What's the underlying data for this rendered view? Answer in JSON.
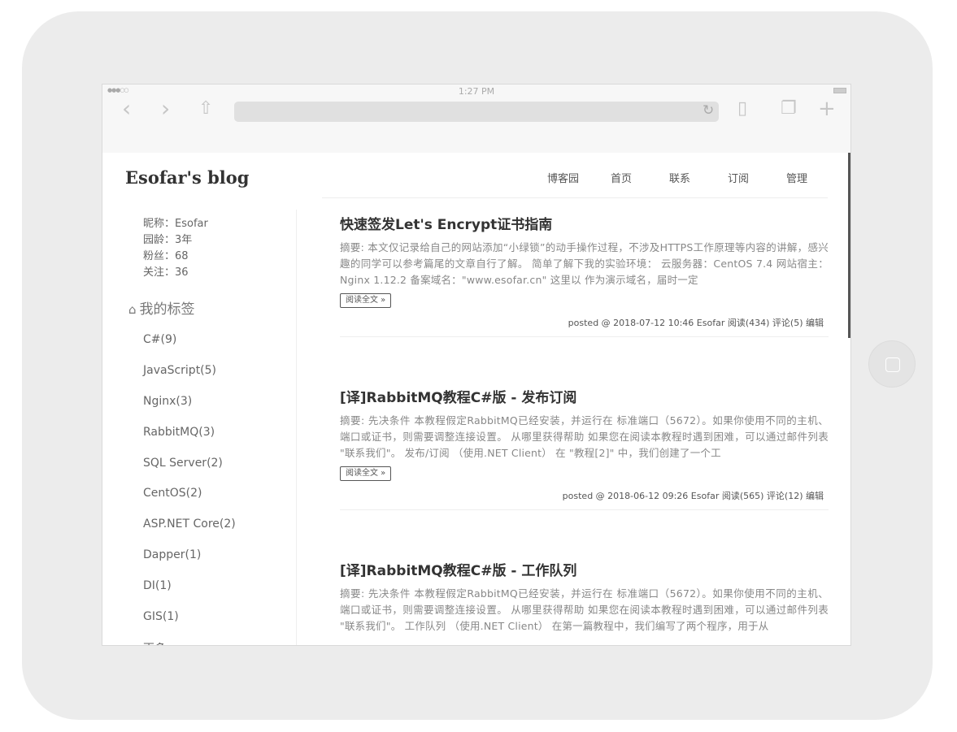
{
  "status_bar": {
    "signal": "●●●○○",
    "time": "1:27 PM"
  },
  "browser": {
    "back": "‹",
    "forward": "›",
    "share": "⇧",
    "reload": "↻",
    "bookmarks": "▯",
    "tabs": "❐",
    "add": "+"
  },
  "blog": {
    "title": "Esofar's blog",
    "nav": [
      "博客园",
      "首页",
      "联系",
      "订阅",
      "管理"
    ]
  },
  "profile": {
    "nickname": "昵称：Esofar",
    "age": "园龄：3年",
    "followers": "粉丝：68",
    "following": "关注：36"
  },
  "tags": {
    "heading": "我的标签",
    "items": [
      "C#(9)",
      "JavaScript(5)",
      "Nginx(3)",
      "RabbitMQ(3)",
      "SQL Server(2)",
      "CentOS(2)",
      "ASP.NET Core(2)",
      "Dapper(1)",
      "DI(1)",
      "GIS(1)"
    ],
    "more": "更多"
  },
  "posts": [
    {
      "title": "快速签发Let's Encrypt证书指南",
      "summary": "摘要: 本文仅记录给自己的网站添加“小绿锁”的动手操作过程，不涉及HTTPS工作原理等内容的讲解，感兴趣的同学可以参考篇尾的文章自行了解。 简单了解下我的实验环境： 云服务器：CentOS 7.4 网站宿主：Nginx 1.12.2 备案域名：\"www.esofar.cn\" 这里以 作为演示域名，届时一定",
      "read_more": "阅读全文 »",
      "footer": "posted @ 2018-07-12 10:46 Esofar 阅读(434) 评论(5) 编辑"
    },
    {
      "title": "[译]RabbitMQ教程C#版 - 发布订阅",
      "summary": "摘要: 先决条件 本教程假定RabbitMQ已经安装，并运行在 标准端口（5672）。如果你使用不同的主机、端口或证书，则需要调整连接设置。 从哪里获得帮助 如果您在阅读本教程时遇到困难，可以通过邮件列表 \"联系我们\"。 发布/订阅 （使用.NET Client） 在 \"教程[2]\" 中，我们创建了一个工",
      "read_more": "阅读全文 »",
      "footer": "posted @ 2018-06-12 09:26 Esofar 阅读(565) 评论(12) 编辑"
    },
    {
      "title": "[译]RabbitMQ教程C#版 - 工作队列",
      "summary": "摘要: 先决条件 本教程假定RabbitMQ已经安装，并运行在 标准端口（5672）。如果你使用不同的主机、端口或证书，则需要调整连接设置。 从哪里获得帮助 如果您在阅读本教程时遇到困难，可以通过邮件列表 \"联系我们\"。 工作队列 （使用.NET Client） 在第一篇教程中，我们编写了两个程序，用于从"
    }
  ]
}
